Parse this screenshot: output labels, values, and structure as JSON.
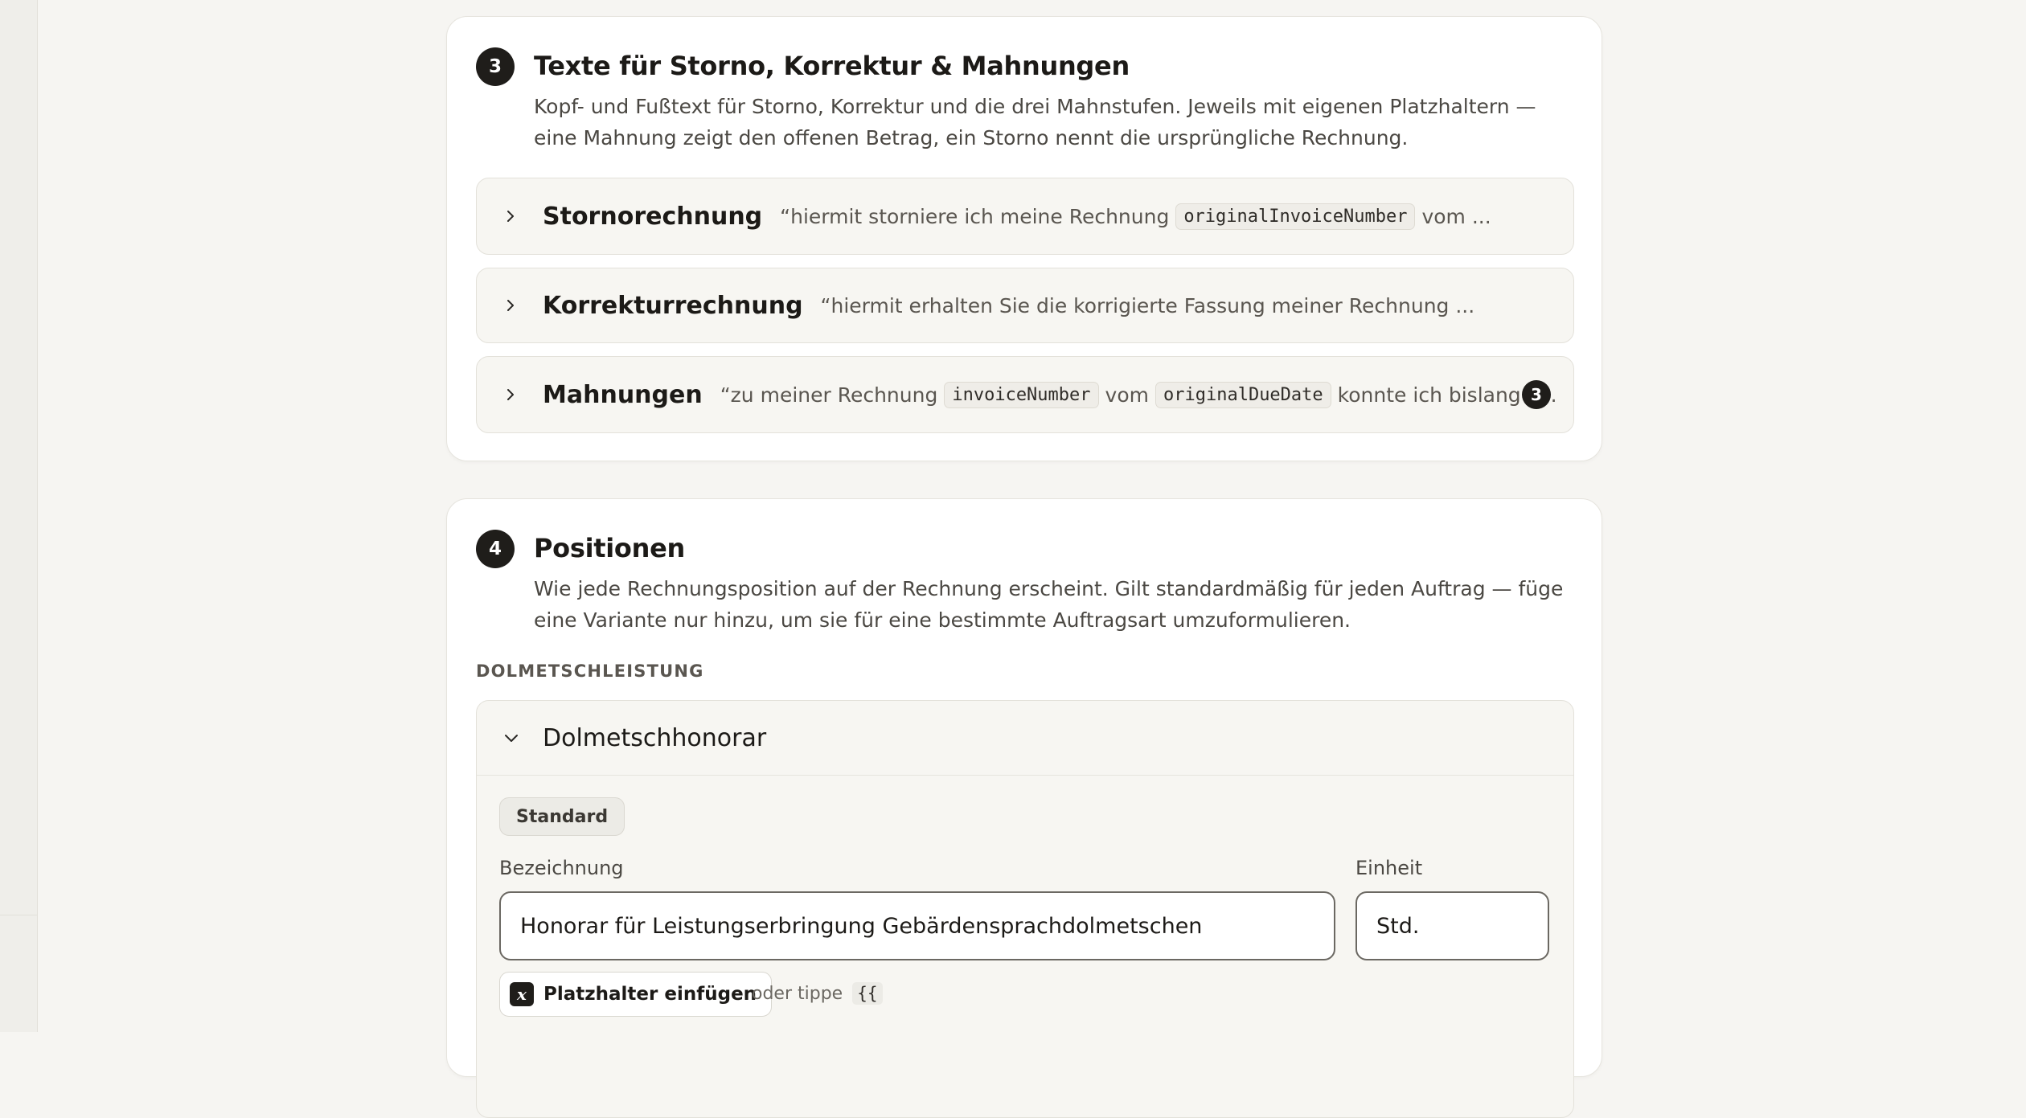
{
  "section3": {
    "step": "3",
    "title": "Texte für Storno, Korrektur & Mahnungen",
    "description": "Kopf- und Fußtext für Storno, Korrektur und die drei Mahnstufen. Jeweils mit eigenen Platzhaltern — eine Mahnung zeigt den offenen Betrag, ein Storno nennt die ursprüngliche Rechnung.",
    "items": [
      {
        "title": "Stornorechnung",
        "preview_a": "“hiermit storniere ich meine Rechnung",
        "code_a": "originalInvoiceNumber",
        "preview_b": "vom ..."
      },
      {
        "title": "Korrekturrechnung",
        "preview_a": "“hiermit erhalten Sie die korrigierte Fassung meiner Rechnung ..."
      },
      {
        "title": "Mahnungen",
        "preview_a": "“zu meiner Rechnung",
        "code_a": "invoiceNumber",
        "preview_b": "vom",
        "code_b": "originalDueDate",
        "preview_c": "konnte ich bislang ke...",
        "count": "3"
      }
    ]
  },
  "section4": {
    "step": "4",
    "title": "Positionen",
    "description": "Wie jede Rechnungsposition auf der Rechnung erscheint. Gilt standardmäßig für jeden Auftrag — füge eine Variante nur hinzu, um sie für eine bestimmte Auftragsart umzuformulieren.",
    "group_label": "DOLMETSCHLEISTUNG",
    "position": {
      "title": "Dolmetschhonorar",
      "variant_chip": "Standard",
      "label_bezeichnung": "Bezeichnung",
      "value_bezeichnung": "Honorar für Leistungserbringung Gebärdensprachdolmetschen",
      "label_einheit": "Einheit",
      "value_einheit": "Std.",
      "placeholder_button": "Platzhalter einfügen",
      "placeholder_icon": "x",
      "hint_text": "oder tippe",
      "hint_code": "{{"
    }
  }
}
